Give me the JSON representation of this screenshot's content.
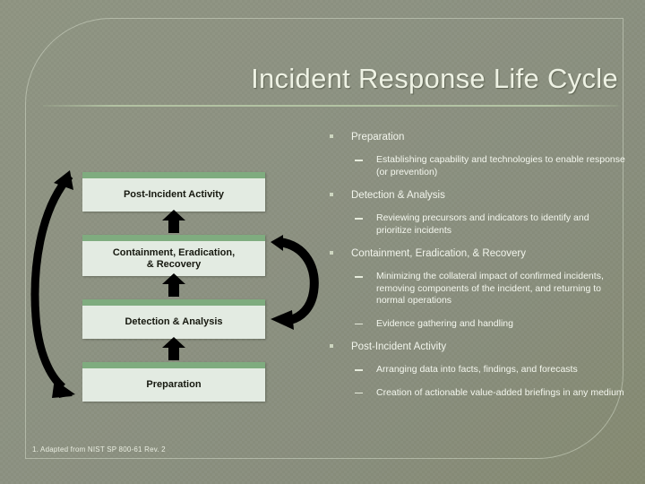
{
  "slide": {
    "title": "Incident Response Life Cycle",
    "footnote": "1. Adapted from NIST SP 800-61 Rev. 2",
    "colors": {
      "background": "#8b9080",
      "box_bar": "#7fac7f",
      "box_body": "#e3ebe2",
      "title_text": "#eef2e4",
      "body_text": "#f2f5ec",
      "arrow": "#000000"
    }
  },
  "diagram": {
    "name": "incident-response-life-cycle",
    "boxes": [
      {
        "label": "Post-Incident Activity"
      },
      {
        "label": "Containment, Eradication,\n& Recovery"
      },
      {
        "label": "Detection & Analysis"
      },
      {
        "label": "Preparation"
      }
    ],
    "box_labels": {
      "post_incident": "Post-Incident Activity",
      "containment_line1": "Containment, Eradication,",
      "containment_line2": "& Recovery",
      "detection": "Detection & Analysis",
      "preparation": "Preparation"
    },
    "arrows": [
      {
        "name": "up-arrow-detection-to-containment",
        "direction": "up"
      },
      {
        "name": "up-arrow-containment-to-post-incident",
        "direction": "up"
      },
      {
        "name": "up-arrow-preparation-to-detection",
        "direction": "up"
      },
      {
        "name": "curved-arrow-right-containment-to-detection",
        "direction": "curve-down-left"
      },
      {
        "name": "curved-arrow-left-post-incident-to-preparation",
        "direction": "curve-down-right"
      }
    ]
  },
  "bullets": [
    {
      "level": 1,
      "text": "Preparation",
      "children": [
        {
          "level": 2,
          "text": "Establishing capability and technologies to enable response (or prevention)"
        }
      ]
    },
    {
      "level": 1,
      "text": "Detection & Analysis",
      "children": [
        {
          "level": 2,
          "text": "Reviewing precursors and indicators to identify and prioritize incidents"
        }
      ]
    },
    {
      "level": 1,
      "text": "Containment, Eradication, & Recovery",
      "children": [
        {
          "level": 2,
          "text": "Minimizing the collateral impact of confirmed incidents, removing components of the incident, and returning to normal operations"
        },
        {
          "level": 2,
          "text": "Evidence gathering and handling"
        }
      ]
    },
    {
      "level": 1,
      "text": "Post-Incident Activity",
      "children": [
        {
          "level": 2,
          "text": "Arranging data into facts, findings, and forecasts"
        },
        {
          "level": 2,
          "text": "Creation of actionable value-added briefings in any medium"
        }
      ]
    }
  ],
  "bullet_flat": {
    "i0": "Preparation",
    "i1": "Establishing capability and technologies to enable response (or prevention)",
    "i2": "Detection & Analysis",
    "i3": "Reviewing precursors and indicators to identify and prioritize incidents",
    "i4": "Containment, Eradication, & Recovery",
    "i5": "Minimizing the collateral impact of confirmed incidents, removing components of the incident, and returning to normal operations",
    "i6": "Evidence gathering and handling",
    "i7": "Post-Incident Activity",
    "i8": "Arranging data into facts, findings, and forecasts",
    "i9": "Creation of actionable value-added briefings in any medium"
  }
}
